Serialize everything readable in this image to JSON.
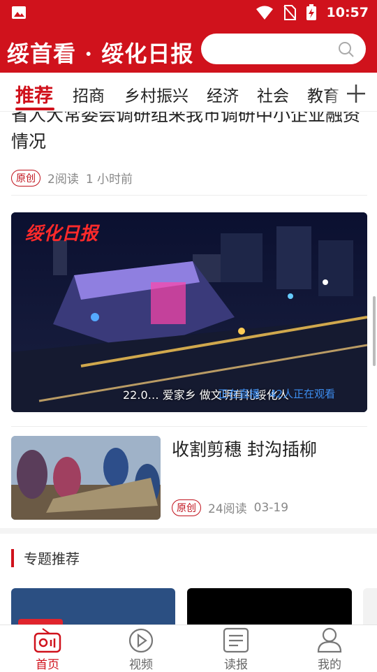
{
  "status": {
    "time": "10:57"
  },
  "header": {
    "logo_text": "绥首看 · 绥化日报",
    "search_placeholder": ""
  },
  "tabs": [
    "推荐",
    "招商",
    "乡村振兴",
    "经济",
    "社会",
    "教育"
  ],
  "articles": [
    {
      "title": "省人大常委会调研组来我市调研中小企业融资情况",
      "badge": "原创",
      "reads": "2阅读",
      "time": "1  小时前"
    },
    {
      "title": "收割剪穗  封沟插柳",
      "badge": "原创",
      "reads": "24阅读",
      "time": "03-19"
    }
  ],
  "video": {
    "logo": "绥化日报",
    "caption": "22.0… 爱家乡 做文明有礼绥化人",
    "live": "正在直播",
    "viewers": "42人正在观看"
  },
  "section": {
    "title": "专题推荐"
  },
  "bottom_nav": [
    {
      "label": "首页",
      "icon": "radio-icon"
    },
    {
      "label": "视频",
      "icon": "play-icon"
    },
    {
      "label": "读报",
      "icon": "newspaper-icon"
    },
    {
      "label": "我的",
      "icon": "user-icon"
    }
  ],
  "colors": {
    "brand": "#d0121c"
  }
}
